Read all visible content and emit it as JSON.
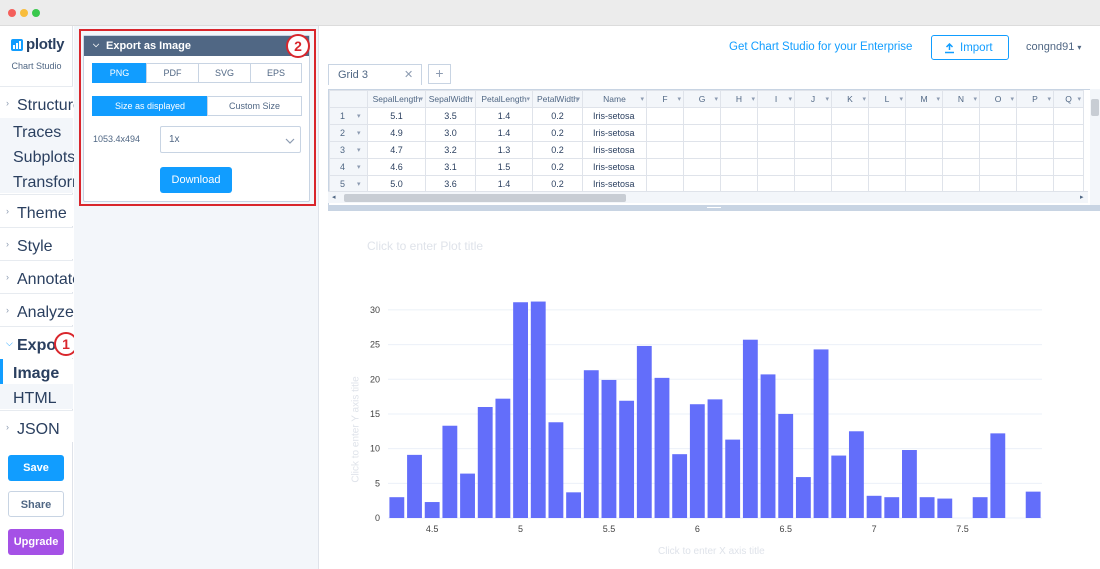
{
  "window": {
    "dots": [
      "#f45f5b",
      "#f8bd3c",
      "#39c84c"
    ]
  },
  "brand": {
    "name": "plotly",
    "product": "Chart Studio"
  },
  "sidebar": {
    "groups": [
      {
        "label": "Structure",
        "expanded": true,
        "items": [
          "Traces",
          "Subplots",
          "Transforms"
        ]
      },
      {
        "label": "Theme"
      },
      {
        "label": "Style"
      },
      {
        "label": "Annotate"
      },
      {
        "label": "Analyze"
      },
      {
        "label": "Export",
        "expanded": true,
        "items": [
          "Image",
          "HTML"
        ],
        "active_item": "Image"
      },
      {
        "label": "JSON"
      }
    ],
    "buttons": {
      "save": "Save",
      "share": "Share",
      "upgrade": "Upgrade"
    }
  },
  "export_panel": {
    "title": "Export as Image",
    "formats": [
      "PNG",
      "PDF",
      "SVG",
      "EPS"
    ],
    "selected_format": "PNG",
    "size_modes": [
      "Size as displayed",
      "Custom Size"
    ],
    "selected_size_mode": "Size as displayed",
    "dimensions": "1053.4x494",
    "scale_value": "1x",
    "download_label": "Download"
  },
  "callouts": [
    "1",
    "2"
  ],
  "header": {
    "enterprise_link": "Get Chart Studio for your Enterprise",
    "import_label": "Import",
    "username": "congnd91"
  },
  "grid": {
    "tab_label": "Grid 3",
    "columns": [
      "SepalLength",
      "SepalWidth",
      "PetalLength",
      "PetalWidth",
      "Name",
      "F",
      "G",
      "H",
      "I",
      "J",
      "K",
      "L",
      "M",
      "N",
      "O",
      "P",
      "Q"
    ],
    "rows": [
      [
        "1",
        "5.1",
        "3.5",
        "1.4",
        "0.2",
        "Iris-setosa"
      ],
      [
        "2",
        "4.9",
        "3.0",
        "1.4",
        "0.2",
        "Iris-setosa"
      ],
      [
        "3",
        "4.7",
        "3.2",
        "1.3",
        "0.2",
        "Iris-setosa"
      ],
      [
        "4",
        "4.6",
        "3.1",
        "1.5",
        "0.2",
        "Iris-setosa"
      ],
      [
        "5",
        "5.0",
        "3.6",
        "1.4",
        "0.2",
        "Iris-setosa"
      ]
    ]
  },
  "chart_placeholders": {
    "title": "Click to enter Plot title",
    "xaxis": "Click to enter X axis title",
    "yaxis": "Click to enter Y axis title"
  },
  "chart_data": {
    "type": "bar",
    "color": "#636efa",
    "x": [
      4.3,
      4.4,
      4.5,
      4.6,
      4.7,
      4.8,
      4.9,
      5.0,
      5.1,
      5.2,
      5.3,
      5.4,
      5.5,
      5.6,
      5.7,
      5.8,
      5.9,
      6.0,
      6.1,
      6.2,
      6.3,
      6.4,
      6.5,
      6.6,
      6.7,
      6.8,
      6.9,
      7.0,
      7.1,
      7.2,
      7.3,
      7.4,
      7.6,
      7.7,
      7.9
    ],
    "values": [
      3,
      9.1,
      2.3,
      13.3,
      6.4,
      16,
      17.2,
      31.1,
      31.2,
      13.8,
      3.7,
      21.3,
      19.9,
      16.9,
      24.8,
      20.2,
      9.2,
      16.4,
      17.1,
      11.3,
      25.7,
      20.7,
      15,
      5.9,
      24.3,
      9,
      12.5,
      3.2,
      3,
      9.8,
      3,
      2.8,
      3,
      12.2,
      3.8
    ],
    "xlim": [
      4.25,
      7.95
    ],
    "ylim": [
      0,
      32
    ],
    "xticks": [
      4.5,
      5,
      5.5,
      6,
      6.5,
      7,
      7.5
    ],
    "yticks": [
      0,
      5,
      10,
      15,
      20,
      25,
      30
    ],
    "grid": true
  }
}
